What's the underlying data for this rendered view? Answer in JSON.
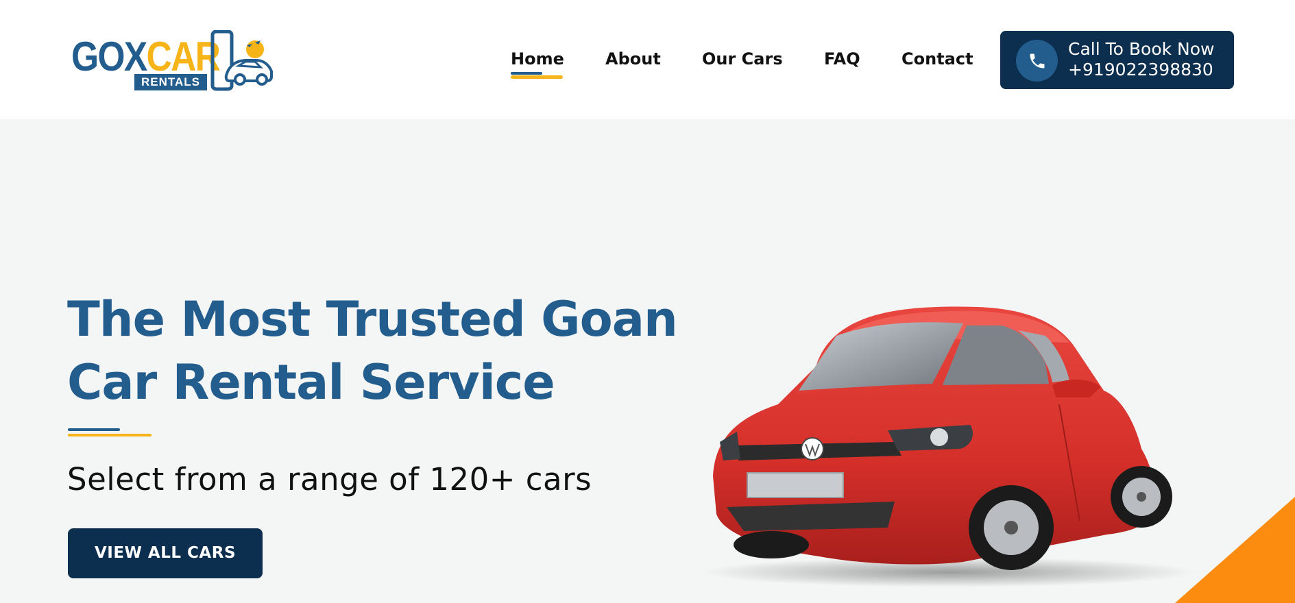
{
  "header": {
    "logo": {
      "word_left": "GOX",
      "word_right": "CAR",
      "badge": "RENTALS"
    },
    "nav": [
      {
        "label": "Home",
        "active": true
      },
      {
        "label": "About",
        "active": false
      },
      {
        "label": "Our Cars",
        "active": false
      },
      {
        "label": "FAQ",
        "active": false
      },
      {
        "label": "Contact",
        "active": false
      }
    ],
    "cta": {
      "icon": "phone-icon",
      "line1": "Call To Book Now",
      "line2": "+919022398830"
    }
  },
  "hero": {
    "title_line1": "The Most Trusted Goan",
    "title_line2": "Car Rental Service",
    "subtitle": "Select from a range of 120+ cars",
    "button": "VIEW ALL CARS"
  },
  "colors": {
    "brand_blue": "#235d8e",
    "navy": "#0d2f4f",
    "yellow": "#f6b418",
    "orange": "#fb8c0f",
    "background": "#f4f5f5"
  }
}
